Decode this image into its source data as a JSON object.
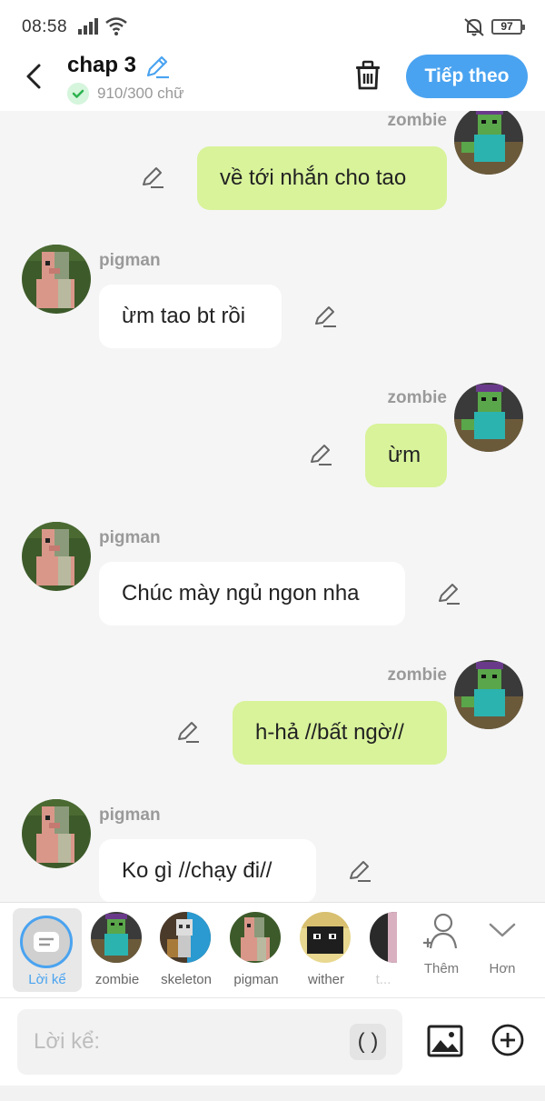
{
  "status_bar": {
    "time": "08:58",
    "battery": "97"
  },
  "header": {
    "title": "chap 3",
    "word_count": "910/300 chữ",
    "next_label": "Tiếp theo"
  },
  "messages": [
    {
      "side": "right",
      "sender": "zombie",
      "text": "về tới nhắn cho tao"
    },
    {
      "side": "left",
      "sender": "pigman",
      "text": "ừm tao bt rồi"
    },
    {
      "side": "right",
      "sender": "zombie",
      "text": "ừm"
    },
    {
      "side": "left",
      "sender": "pigman",
      "text": "Chúc mày ngủ ngon nha"
    },
    {
      "side": "right",
      "sender": "zombie",
      "text": "h-hả //bất ngờ//"
    },
    {
      "side": "left",
      "sender": "pigman",
      "text": "Ko gì //chạy đi//"
    }
  ],
  "characters": {
    "narrator_label": "Lời kể",
    "items": [
      "zombie",
      "skeleton",
      "pigman",
      "wither",
      "t..."
    ],
    "add_label": "Thêm",
    "more_label": "Hơn"
  },
  "input": {
    "placeholder": "Lời kể:",
    "paren_label": "( )"
  },
  "colors": {
    "accent": "#4aa3f0",
    "bubble_right": "#d8f39a",
    "bubble_left": "#ffffff",
    "background": "#f5f5f5"
  }
}
